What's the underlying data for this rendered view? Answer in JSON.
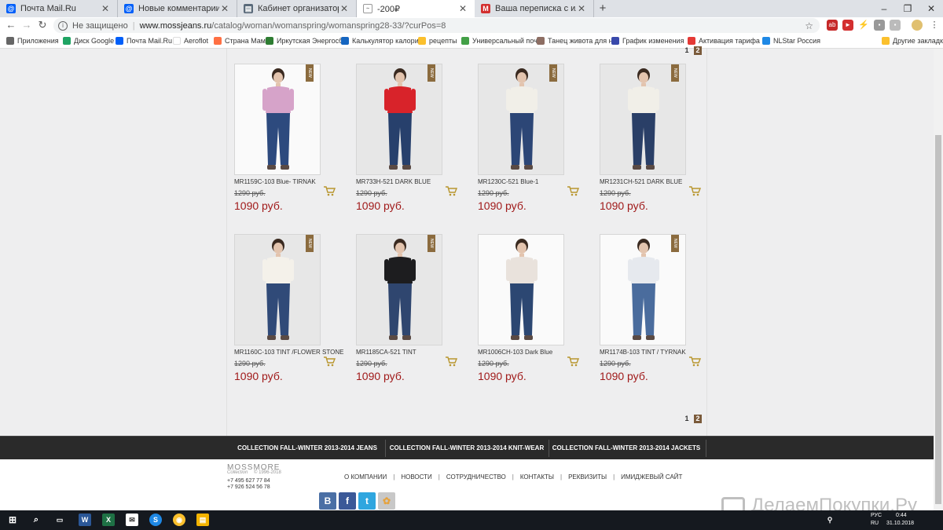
{
  "browser": {
    "tabs": [
      {
        "title": "Почта Mail.Ru",
        "favicon": "mail-ru-icon",
        "color": "#005ff9"
      },
      {
        "title": "Новые комментарии",
        "favicon": "mail-ru-icon",
        "color": "#005ff9"
      },
      {
        "title": "Кабинет организатора | «Делае",
        "favicon": "page-icon",
        "color": "#5a6a7a"
      },
      {
        "title": "-200₽",
        "favicon": "moss-icon",
        "color": "#777777"
      },
      {
        "title": "Ваша переписка с ильмирочка",
        "favicon": "m-icon",
        "color": "#d32f2f"
      }
    ],
    "new_tab": "+",
    "window_controls": {
      "minimize": "–",
      "restore": "❐",
      "close": "✕"
    },
    "security": "Не защищено",
    "url_host": "www.mossjeans.ru",
    "url_path": "/catalog/woman/womanspring/womanspring28-33/?curPos=8"
  },
  "bookmarks": [
    {
      "label": "Приложения",
      "color": "#666666"
    },
    {
      "label": "Диск Google",
      "color": "#1fa463"
    },
    {
      "label": "Почта Mail.Ru",
      "color": "#005ff9"
    },
    {
      "label": "Aeroflot",
      "color": "#ffffff"
    },
    {
      "label": "Страна Мам",
      "color": "#ff7043"
    },
    {
      "label": "Иркутская Энергосб",
      "color": "#2e7d32"
    },
    {
      "label": "Калькулятор калори",
      "color": "#1565c0"
    },
    {
      "label": "рецепты",
      "color": "#fbc02d"
    },
    {
      "label": "Универсальный поч",
      "color": "#43a047"
    },
    {
      "label": "Танец живота для н",
      "color": "#8d6e63"
    },
    {
      "label": "График изменения",
      "color": "#3949ab"
    },
    {
      "label": "Активация тарифа",
      "color": "#e53935"
    },
    {
      "label": "NLStar Россия",
      "color": "#1e88e5"
    }
  ],
  "other_bookmarks": "Другие закладки",
  "pager": {
    "pages": [
      "1",
      "2"
    ]
  },
  "products": [
    {
      "name": "MR1159C-103 Blue- TIRNAK",
      "old_price": "1290 руб.",
      "price": "1090 руб.",
      "badge": "NEW",
      "top": "#d6a3c9",
      "legs": "#2d4a7e",
      "bg": "white"
    },
    {
      "name": "MR733H-521 DARK BLUE",
      "old_price": "1290 руб.",
      "price": "1090 руб.",
      "badge": "NEW",
      "top": "#d8232a",
      "legs": "#27406c",
      "bg": "grey"
    },
    {
      "name": "MR1230C-521 Blue-1",
      "old_price": "1290 руб.",
      "price": "1090 руб.",
      "badge": "NEW",
      "top": "#f1efe8",
      "legs": "#2c4676",
      "bg": "grey"
    },
    {
      "name": "MR1231CH-521 DARK BLUE",
      "old_price": "1290 руб.",
      "price": "1090 руб.",
      "badge": "NEW",
      "top": "#f1efe8",
      "legs": "#2a3f67",
      "bg": "grey"
    },
    {
      "name": "MR1160C-103 TINT /FLOWER STONE",
      "old_price": "1290 руб.",
      "price": "1090 руб.",
      "badge": "NEW",
      "top": "#f4f1ea",
      "legs": "#304a78",
      "bg": "grey"
    },
    {
      "name": "MR1185CA-521 TINT",
      "old_price": "1290 руб.",
      "price": "1090 руб.",
      "badge": "NEW",
      "top": "#1d1d1f",
      "legs": "#2f466f",
      "bg": "grey"
    },
    {
      "name": "MR1006CH-103 Dark Blue",
      "old_price": "1290 руб.",
      "price": "1090 руб.",
      "badge": "",
      "top": "#e9e2dc",
      "legs": "#2c4772",
      "bg": "white"
    },
    {
      "name": "MR1174B-103 TINT / TYRNAK",
      "old_price": "1290 руб.",
      "price": "1090 руб.",
      "badge": "NEW",
      "top": "#e6e9ee",
      "legs": "#4a6c9d",
      "bg": "white"
    }
  ],
  "collections": [
    "COLLECTION FALL-WINTER 2013-2014 JEANS",
    "COLLECTION FALL-WINTER 2013-2014 KNIT-WEAR",
    "COLLECTION FALL-WINTER 2013-2014 JACKETS"
  ],
  "footer": {
    "logo": "MOSSMORE",
    "logo_sub": "Collection",
    "years": "© 1996-2018",
    "phone1": "+7 495 627 77 84",
    "phone2": "+7 926 524 56 78",
    "nav": [
      "О КОМПАНИИ",
      "НОВОСТИ",
      "СОТРУДНИЧЕСТВО",
      "КОНТАКТЫ",
      "РЕКВИЗИТЫ",
      "ИМИДЖЕВЫЙ САЙТ"
    ],
    "nav_sep": "|",
    "social": [
      {
        "label": "B",
        "icon": "vk-icon",
        "color": "#4a6fa5"
      },
      {
        "label": "f",
        "icon": "facebook-icon",
        "color": "#3b5998"
      },
      {
        "label": "t",
        "icon": "twitter-icon",
        "color": "#2fa6df"
      },
      {
        "label": "✿",
        "icon": "odnoklassniki-icon",
        "color": "#c8c8c8"
      }
    ]
  },
  "watermark": "ДелаемПокупки.Ру",
  "taskbar": {
    "lang1": "РУС",
    "lang2": "RU",
    "time": "0:44",
    "date": "31.10.2018"
  }
}
